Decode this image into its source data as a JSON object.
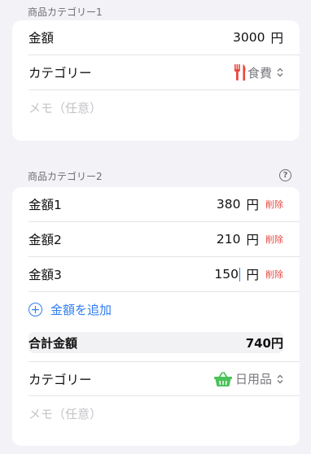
{
  "section1": {
    "label": "商品カテゴリー1",
    "amount_label": "金額",
    "amount_value": "3000",
    "yen": "円",
    "category_label": "カテゴリー",
    "category_value": "食費",
    "memo_placeholder": "メモ（任意）"
  },
  "section2": {
    "label": "商品カテゴリー2",
    "help_icon": "?",
    "items": [
      {
        "label": "金額1",
        "value": "380",
        "yen": "円",
        "delete": "削除"
      },
      {
        "label": "金額2",
        "value": "210",
        "yen": "円",
        "delete": "削除"
      },
      {
        "label": "金額3",
        "value": "150",
        "yen": "円",
        "delete": "削除"
      }
    ],
    "add_label": "金額を追加",
    "total_label": "合計金額",
    "total_value": "740円",
    "category_label": "カテゴリー",
    "category_value": "日用品",
    "memo_placeholder": "メモ（任意）"
  },
  "colors": {
    "accent": "#2f7ef0",
    "delete": "#e5473f",
    "food_icon": "#e8493c",
    "basket_icon": "#4cc25a"
  },
  "icons": {
    "food": "fork-knife-icon",
    "daily": "basket-icon",
    "add": "plus-circle-icon",
    "help": "question-circle-icon",
    "chevron": "chevron-up-down-icon"
  }
}
